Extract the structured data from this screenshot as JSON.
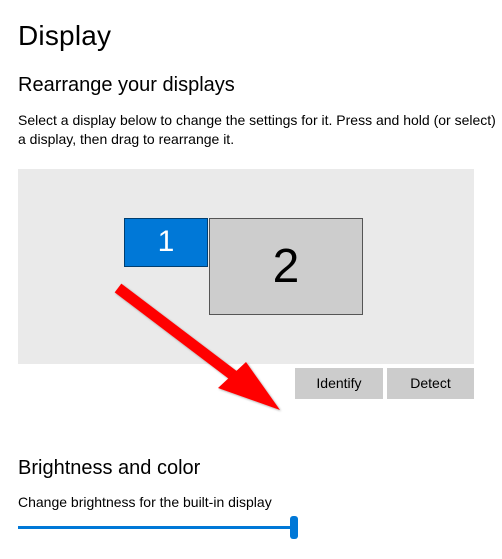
{
  "page_title": "Display",
  "rearrange": {
    "heading": "Rearrange your displays",
    "description": "Select a display below to change the settings for it. Press and hold (or select) a display, then drag to rearrange it.",
    "displays": {
      "d1": {
        "number": "1"
      },
      "d2": {
        "number": "2"
      }
    },
    "identify_label": "Identify",
    "detect_label": "Detect"
  },
  "brightness": {
    "heading": "Brightness and color",
    "label": "Change brightness for the built-in display",
    "value_percent": 100
  },
  "colors": {
    "accent": "#0078d7",
    "canvas_bg": "#eaeaea",
    "button_bg": "#cccccc",
    "arrow": "#ff0000"
  },
  "annotation": {
    "arrow_target": "identify-button"
  }
}
